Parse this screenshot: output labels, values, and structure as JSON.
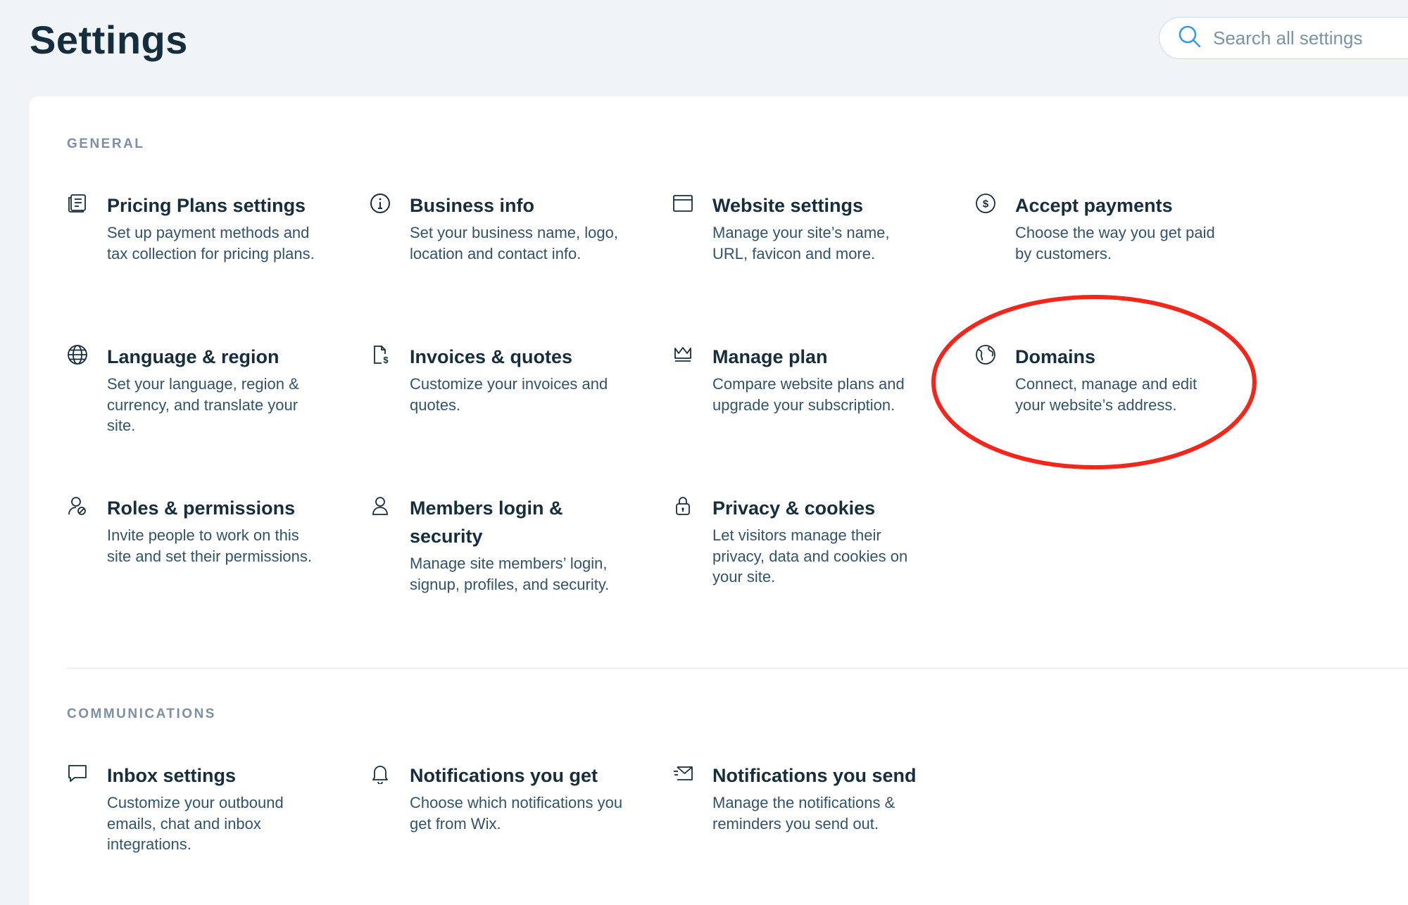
{
  "header": {
    "title": "Settings",
    "search_placeholder": "Search all settings"
  },
  "sections": {
    "general": {
      "label": "GENERAL",
      "items": [
        {
          "icon": "pricing-plans-icon",
          "title": "Pricing Plans settings",
          "desc": "Set up payment methods and tax collection for pricing plans."
        },
        {
          "icon": "info-icon",
          "title": "Business info",
          "desc": "Set your business name, logo, location and contact info."
        },
        {
          "icon": "browser-window-icon",
          "title": "Website settings",
          "desc": "Manage your site’s name, URL, favicon and more."
        },
        {
          "icon": "dollar-circle-icon",
          "title": "Accept payments",
          "desc": "Choose the way you get paid by customers."
        },
        {
          "icon": "globe-icon",
          "title": "Language & region",
          "desc": "Set your language, region & currency, and translate your site."
        },
        {
          "icon": "invoice-icon",
          "title": "Invoices & quotes",
          "desc": "Customize your invoices and quotes."
        },
        {
          "icon": "crown-icon",
          "title": "Manage plan",
          "desc": "Compare website plans and upgrade your subscription."
        },
        {
          "icon": "domain-globe-icon",
          "title": "Domains",
          "desc": "Connect, manage and edit your website’s address."
        },
        {
          "icon": "user-permissions-icon",
          "title": "Roles & permissions",
          "desc": "Invite people to work on this site and set their permissions."
        },
        {
          "icon": "member-icon",
          "title": "Members login & security",
          "desc": "Manage site members’ login, signup, profiles, and security."
        },
        {
          "icon": "lock-icon",
          "title": "Privacy & cookies",
          "desc": "Let visitors manage their privacy, data and cookies on your site."
        }
      ]
    },
    "communications": {
      "label": "COMMUNICATIONS",
      "items": [
        {
          "icon": "chat-bubble-icon",
          "title": "Inbox settings",
          "desc": "Customize your outbound emails, chat and inbox integrations."
        },
        {
          "icon": "bell-icon",
          "title": "Notifications you get",
          "desc": "Choose which notifications you get from Wix."
        },
        {
          "icon": "send-mail-icon",
          "title": "Notifications you send",
          "desc": "Manage the notifications & reminders you send out."
        }
      ]
    }
  },
  "colors": {
    "background": "#f0f4f7",
    "text_primary": "#162d3d",
    "text_secondary": "#32536a",
    "section_label": "#7d8fa8",
    "search_icon": "#3899ec",
    "highlight_annotation": "#f2261b"
  }
}
